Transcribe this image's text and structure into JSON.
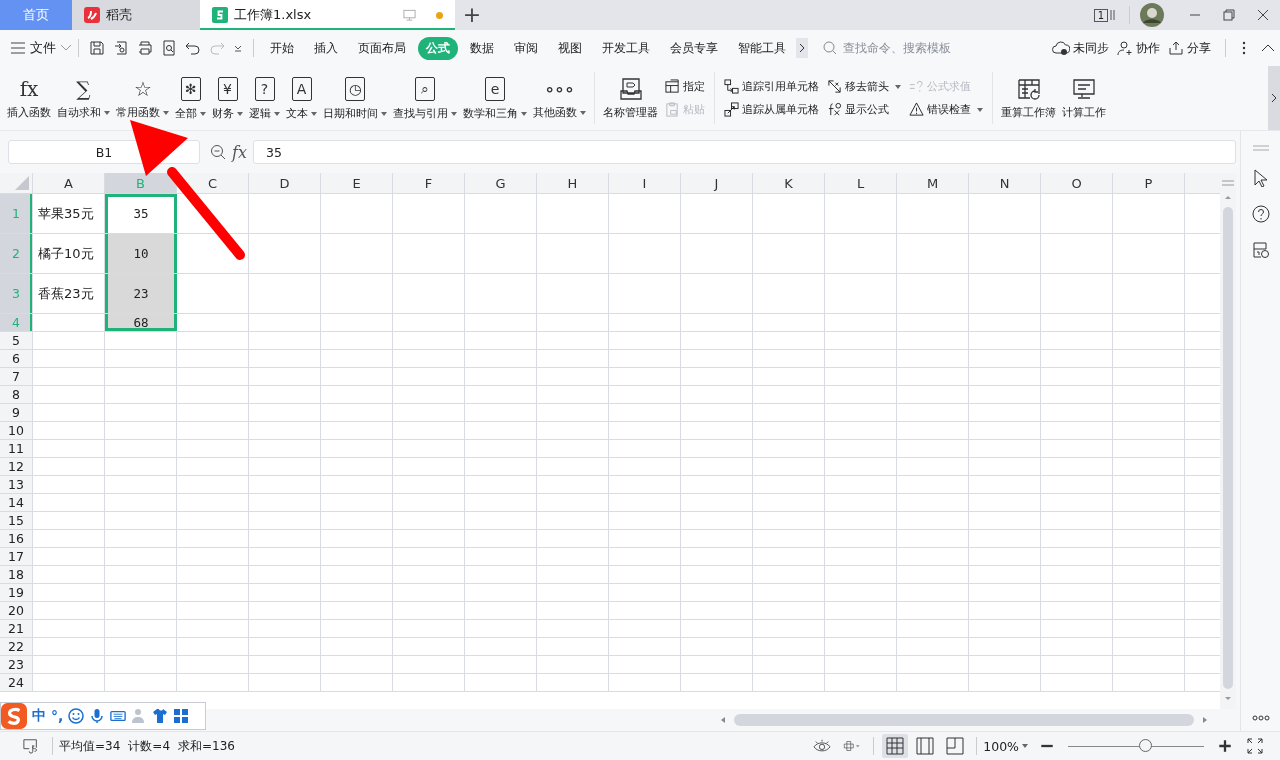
{
  "tabs": [
    {
      "label": "首页",
      "selected": false,
      "kind": "home"
    },
    {
      "label": "稻壳",
      "selected": false,
      "kind": "docer"
    },
    {
      "label": "工作簿1.xlsx",
      "selected": true,
      "kind": "file",
      "unsaved": true
    }
  ],
  "new_tab": "+",
  "window_count": "1",
  "menu": {
    "file": "文件",
    "tabs": [
      {
        "label": "开始",
        "selected": false
      },
      {
        "label": "插入",
        "selected": false
      },
      {
        "label": "页面布局",
        "selected": false
      },
      {
        "label": "公式",
        "selected": true
      },
      {
        "label": "数据",
        "selected": false
      },
      {
        "label": "审阅",
        "selected": false
      },
      {
        "label": "视图",
        "selected": false
      },
      {
        "label": "开发工具",
        "selected": false
      },
      {
        "label": "会员专享",
        "selected": false
      },
      {
        "label": "智能工具",
        "selected": false
      }
    ],
    "search": {
      "placeholder": "查找命令、搜索模板"
    },
    "actions": [
      "未同步",
      "协作",
      "分享"
    ]
  },
  "ribbon": {
    "functions": [
      {
        "label": "插入函数",
        "glyph": "fx",
        "framed": false,
        "dropdown": false
      },
      {
        "label": "自动求和",
        "glyph": "∑",
        "framed": false,
        "dropdown": true
      },
      {
        "label": "常用函数",
        "glyph": "☆",
        "framed": false,
        "dropdown": true
      },
      {
        "label": "全部",
        "glyph": "✻",
        "framed": true,
        "dropdown": true
      },
      {
        "label": "财务",
        "glyph": "¥",
        "framed": true,
        "dropdown": true
      },
      {
        "label": "逻辑",
        "glyph": "?",
        "framed": true,
        "dropdown": true
      },
      {
        "label": "文本",
        "glyph": "A",
        "framed": true,
        "dropdown": true
      },
      {
        "label": "日期和时间",
        "glyph": "◷",
        "framed": true,
        "dropdown": true
      },
      {
        "label": "查找与引用",
        "glyph": "⌕",
        "framed": true,
        "dropdown": true
      },
      {
        "label": "数学和三角",
        "glyph": "e",
        "framed": true,
        "dropdown": true
      },
      {
        "label": "其他函数",
        "glyph": "∘∘∘",
        "framed": false,
        "dropdown": true
      }
    ],
    "name_manager": "名称管理器",
    "small_columns": [
      [
        {
          "label": "指定",
          "kind": "define",
          "disabled": false,
          "dropdown": false
        },
        {
          "label": "粘贴",
          "kind": "paste",
          "disabled": true,
          "dropdown": false
        }
      ],
      [
        {
          "label": "追踪引用单元格",
          "kind": "trace-precedents",
          "disabled": false,
          "dropdown": false
        },
        {
          "label": "追踪从属单元格",
          "kind": "trace-dependents",
          "disabled": false,
          "dropdown": false
        }
      ],
      [
        {
          "label": "移去箭头",
          "kind": "remove-arrows",
          "disabled": false,
          "dropdown": true
        },
        {
          "label": "显示公式",
          "kind": "show-formulas",
          "disabled": false,
          "dropdown": false
        }
      ],
      [
        {
          "label": "公式求值",
          "kind": "evaluate",
          "disabled": true,
          "dropdown": false
        },
        {
          "label": "错误检查",
          "kind": "error-check",
          "disabled": false,
          "dropdown": true
        }
      ]
    ],
    "calc": [
      "重算工作簿",
      "计算工作"
    ]
  },
  "formula_bar": {
    "name_box": "B1",
    "fx": "fx",
    "value": "35"
  },
  "grid": {
    "columns": [
      {
        "label": "A",
        "selected": false
      },
      {
        "label": "B",
        "selected": true
      },
      {
        "label": "C",
        "selected": false
      },
      {
        "label": "D",
        "selected": false
      },
      {
        "label": "E",
        "selected": false
      },
      {
        "label": "F",
        "selected": false
      },
      {
        "label": "G",
        "selected": false
      },
      {
        "label": "H",
        "selected": false
      },
      {
        "label": "I",
        "selected": false
      },
      {
        "label": "J",
        "selected": false
      },
      {
        "label": "K",
        "selected": false
      },
      {
        "label": "L",
        "selected": false
      },
      {
        "label": "M",
        "selected": false
      },
      {
        "label": "N",
        "selected": false
      },
      {
        "label": "O",
        "selected": false
      },
      {
        "label": "P",
        "selected": false
      }
    ],
    "rows": [
      {
        "label": "1",
        "selected": true,
        "cells": [
          {
            "text": "苹果35元",
            "selected": false,
            "active": false
          },
          {
            "text": "35",
            "selected": true,
            "active": true
          }
        ]
      },
      {
        "label": "2",
        "selected": true,
        "cells": [
          {
            "text": "橘子10元",
            "selected": false,
            "active": false
          },
          {
            "text": "10",
            "selected": true,
            "active": false
          }
        ]
      },
      {
        "label": "3",
        "selected": true,
        "cells": [
          {
            "text": "香蕉23元",
            "selected": false,
            "active": false
          },
          {
            "text": "23",
            "selected": true,
            "active": false
          }
        ]
      },
      {
        "label": "4",
        "selected": true,
        "cells": [
          {
            "text": "",
            "selected": false,
            "active": false
          },
          {
            "text": "68",
            "selected": true,
            "active": false
          }
        ]
      },
      {
        "label": "5",
        "selected": false
      },
      {
        "label": "6",
        "selected": false
      },
      {
        "label": "7",
        "selected": false
      },
      {
        "label": "8",
        "selected": false
      },
      {
        "label": "9",
        "selected": false
      },
      {
        "label": "10",
        "selected": false
      },
      {
        "label": "11",
        "selected": false
      },
      {
        "label": "12",
        "selected": false
      },
      {
        "label": "13",
        "selected": false
      },
      {
        "label": "14",
        "selected": false
      },
      {
        "label": "15",
        "selected": false
      },
      {
        "label": "16",
        "selected": false
      },
      {
        "label": "17",
        "selected": false
      },
      {
        "label": "18",
        "selected": false
      },
      {
        "label": "19",
        "selected": false
      },
      {
        "label": "20",
        "selected": false
      },
      {
        "label": "21",
        "selected": false
      },
      {
        "label": "22",
        "selected": false
      },
      {
        "label": "23",
        "selected": false
      },
      {
        "label": "24",
        "selected": false
      }
    ]
  },
  "ime": {
    "mode": "中",
    "punct": "°,"
  },
  "status": {
    "stats": [
      "平均值=34",
      "计数=4",
      "求和=136"
    ],
    "views": [
      {
        "selected": true
      },
      {
        "selected": false
      },
      {
        "selected": false
      }
    ],
    "zoom": "100%",
    "zoom_slider": {
      "level": 0.57
    }
  }
}
